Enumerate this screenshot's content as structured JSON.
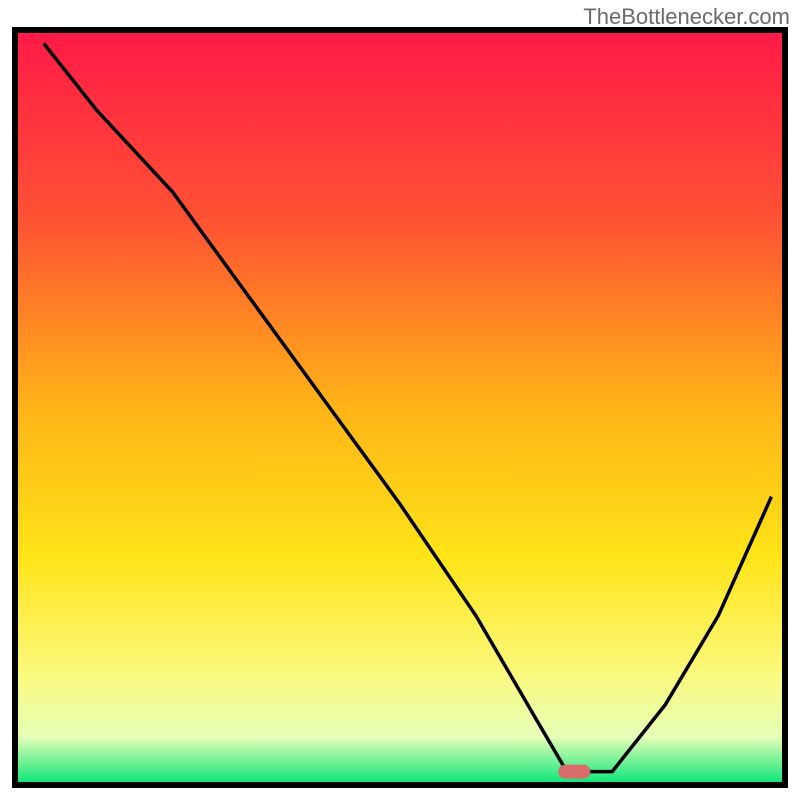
{
  "attribution": "TheBottlenecker.com",
  "chart_data": {
    "type": "line",
    "title": "",
    "xlabel": "",
    "ylabel": "",
    "xlim": [
      0,
      100
    ],
    "ylim": [
      0,
      100
    ],
    "background_gradient": {
      "stops": [
        {
          "offset": 0,
          "color": "#ff1a47"
        },
        {
          "offset": 25,
          "color": "#ff5233"
        },
        {
          "offset": 50,
          "color": "#ffb417"
        },
        {
          "offset": 70,
          "color": "#ffe418"
        },
        {
          "offset": 85,
          "color": "#fcf97a"
        },
        {
          "offset": 94,
          "color": "#e6ffb8"
        },
        {
          "offset": 100,
          "color": "#12e67a"
        }
      ]
    },
    "series": [
      {
        "name": "bottleneck-curve",
        "x": [
          3,
          10,
          20,
          30,
          40,
          50,
          60,
          68,
          72,
          78,
          85,
          92,
          99
        ],
        "values": [
          99,
          90,
          79,
          65,
          51,
          37,
          22,
          8,
          1,
          1,
          10,
          22,
          38
        ]
      }
    ],
    "marker": {
      "name": "optimal-point",
      "x": 73,
      "y": 1,
      "color": "#d96b6b"
    },
    "frame": {
      "stroke": "#000000",
      "strokeWidth": 6
    }
  }
}
